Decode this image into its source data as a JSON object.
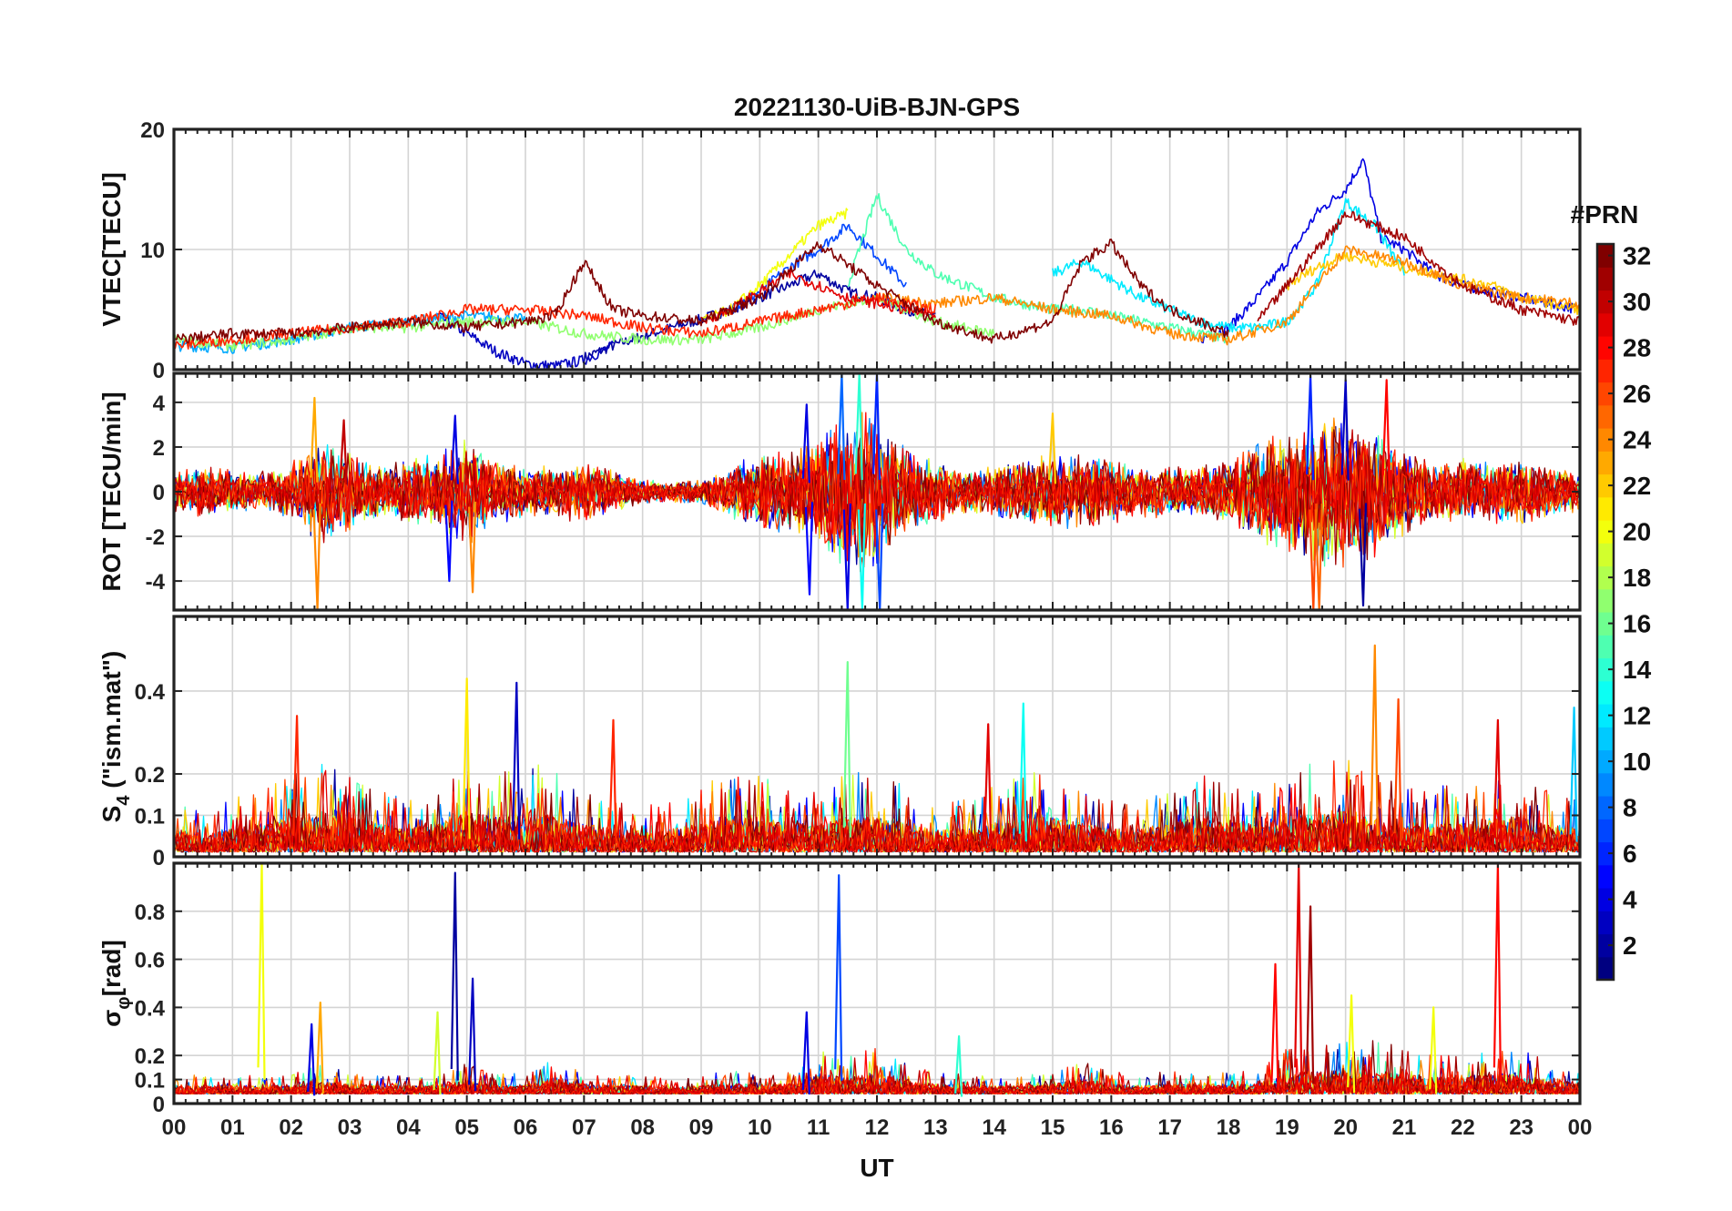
{
  "figure": {
    "title": "20221130-UiB-BJN-GPS",
    "xlabel": "UT",
    "colorbar_label": "#PRN"
  },
  "x_ticks": [
    "00",
    "01",
    "02",
    "03",
    "04",
    "05",
    "06",
    "07",
    "08",
    "09",
    "10",
    "11",
    "12",
    "13",
    "14",
    "15",
    "16",
    "17",
    "18",
    "19",
    "20",
    "21",
    "22",
    "23",
    "00"
  ],
  "colorbar": {
    "min": 1,
    "max": 32,
    "ticks": [
      2,
      4,
      6,
      8,
      10,
      12,
      14,
      16,
      18,
      20,
      22,
      24,
      26,
      28,
      30,
      32
    ]
  },
  "chart_data": [
    {
      "type": "line",
      "panel": "vtec",
      "ylabel": "VTEC[TECU]",
      "xlim": [
        0,
        24
      ],
      "ylim": [
        0,
        20
      ],
      "yticks": [
        0,
        10,
        20
      ],
      "ytick_labels": [
        "0",
        "10",
        "20"
      ],
      "grid": true,
      "series": [
        {
          "prn": 2,
          "x": [
            7,
            7.5,
            8,
            8.5,
            9,
            9.5,
            10,
            10.5,
            11,
            11.5,
            12,
            12.5,
            13
          ],
          "values": [
            1,
            2,
            2.8,
            3.5,
            4.2,
            5,
            6,
            7,
            8,
            6.5,
            6,
            5,
            4.5
          ]
        },
        {
          "prn": 3,
          "x": [
            4.5,
            5,
            5.5,
            6,
            6.5,
            7,
            7.5
          ],
          "values": [
            4.5,
            3,
            1.5,
            0.5,
            0.3,
            0.8,
            2
          ]
        },
        {
          "prn": 4,
          "x": [
            17.5,
            18,
            18.5,
            19,
            19.5,
            20,
            20.3,
            20.6,
            21,
            21.5,
            22,
            22.5,
            23,
            23.5,
            24
          ],
          "values": [
            2.5,
            3.5,
            6,
            9,
            13,
            15,
            17.5,
            11,
            10,
            8,
            7,
            6.5,
            6,
            5.5,
            5
          ]
        },
        {
          "prn": 7,
          "x": [
            9.5,
            10,
            10.5,
            11,
            11.5,
            12,
            12.5
          ],
          "values": [
            5,
            6.5,
            8.5,
            10,
            12,
            9.5,
            7
          ]
        },
        {
          "prn": 10,
          "x": [
            0,
            1,
            2,
            3,
            4,
            5,
            6
          ],
          "values": [
            2,
            1.8,
            2.5,
            3.5,
            4,
            4.5,
            4.2
          ]
        },
        {
          "prn": 12,
          "x": [
            15,
            15.5,
            16,
            16.5,
            17,
            17.5,
            18,
            18.5,
            19,
            19.5,
            20,
            20.5,
            21
          ],
          "values": [
            8,
            9,
            7.5,
            6,
            5,
            4,
            3.5,
            3.5,
            4,
            7,
            14,
            12,
            8
          ]
        },
        {
          "prn": 15,
          "x": [
            11.5,
            12,
            12.5,
            13,
            13.5,
            14,
            14.5,
            15,
            15.5,
            16,
            16.5,
            17,
            17.5,
            18
          ],
          "values": [
            7,
            14.5,
            10,
            8,
            7,
            6,
            5.5,
            5,
            5,
            4.5,
            4,
            3.5,
            3,
            2.5
          ]
        },
        {
          "prn": 17,
          "x": [
            0,
            1,
            2,
            3,
            4,
            5,
            6,
            7,
            8,
            9,
            10,
            11,
            12,
            13,
            14
          ],
          "values": [
            2.5,
            2,
            2.5,
            3.5,
            3.5,
            4,
            4,
            3,
            2.5,
            2.5,
            3.5,
            5,
            6,
            4,
            3
          ]
        },
        {
          "prn": 20,
          "x": [
            9,
            9.5,
            10,
            10.5,
            11,
            11.5
          ],
          "values": [
            4,
            5,
            7,
            9.5,
            12,
            13
          ]
        },
        {
          "prn": 22,
          "x": [
            19,
            19.5,
            20,
            20.5,
            21,
            21.5,
            22,
            22.5,
            23,
            23.5,
            24
          ],
          "values": [
            7,
            8.5,
            9.5,
            9,
            8.5,
            8,
            7.5,
            7,
            6,
            5.5,
            5
          ]
        },
        {
          "prn": 24,
          "x": [
            12,
            13,
            14,
            15,
            16,
            17,
            18,
            19,
            20,
            21,
            22,
            23,
            24
          ],
          "values": [
            6,
            5.5,
            6,
            5,
            4.5,
            3,
            2.5,
            4,
            10,
            9,
            7,
            6,
            5.5
          ]
        },
        {
          "prn": 27,
          "x": [
            0,
            1,
            2,
            3,
            4,
            5,
            6,
            7,
            8,
            9,
            10,
            11,
            12,
            13
          ],
          "values": [
            2,
            2.5,
            3,
            3.5,
            4,
            5,
            5,
            4.5,
            3.5,
            3,
            4,
            5,
            6,
            5
          ]
        },
        {
          "prn": 29,
          "x": [
            9,
            9.5,
            10,
            10.5,
            11,
            11.5,
            12,
            12.5,
            13
          ],
          "values": [
            4,
            5,
            6.5,
            8,
            7,
            6,
            5.5,
            5,
            4.5
          ]
        },
        {
          "prn": 31,
          "x": [
            18.5,
            19,
            19.5,
            20,
            20.5,
            21,
            21.5,
            22,
            22.5,
            23,
            23.5,
            24
          ],
          "values": [
            4,
            7,
            10,
            13,
            12,
            11,
            9,
            7,
            6,
            5,
            4.5,
            4
          ]
        },
        {
          "prn": 32,
          "x": [
            0,
            1,
            2,
            3,
            4,
            5,
            6,
            6.5,
            7,
            7.5,
            8,
            9,
            10,
            11,
            12,
            13,
            14,
            15,
            15.5,
            16,
            16.5,
            17,
            18
          ],
          "values": [
            2.5,
            3,
            3,
            3.5,
            4,
            3.5,
            4,
            4.5,
            9,
            5,
            4.5,
            4,
            6,
            10.5,
            7,
            4,
            2.5,
            4,
            9,
            10.5,
            7,
            5,
            3
          ]
        }
      ]
    },
    {
      "type": "line",
      "panel": "rot",
      "ylabel": "ROT [TECU/min]",
      "xlim": [
        0,
        24
      ],
      "ylim": [
        -5.3,
        5.3
      ],
      "yticks": [
        -4,
        -2,
        0,
        2,
        4
      ],
      "ytick_labels": [
        "-4",
        "-2",
        "0",
        "2",
        "4"
      ],
      "grid": true,
      "envelope": {
        "x": [
          0,
          0.5,
          1,
          1.5,
          2,
          2.5,
          3,
          3.5,
          4,
          4.5,
          5,
          5.5,
          6,
          6.5,
          7,
          7.5,
          8,
          8.5,
          9,
          9.5,
          10,
          10.5,
          11,
          11.5,
          12,
          12.5,
          13,
          13.5,
          14,
          14.5,
          15,
          15.5,
          16,
          16.5,
          17,
          17.5,
          18,
          18.5,
          19,
          19.5,
          20,
          20.5,
          21,
          21.5,
          22,
          22.5,
          23,
          23.5,
          24
        ],
        "values": [
          1,
          1.2,
          1,
          1,
          1.3,
          2.5,
          2,
          1.2,
          1.5,
          1.8,
          2.5,
          1.5,
          1.2,
          1.2,
          1.5,
          1,
          0.6,
          0.5,
          0.6,
          1.2,
          1.8,
          2,
          2.5,
          4,
          3.5,
          2,
          1.5,
          1,
          1.2,
          1.5,
          1.8,
          1.8,
          1.5,
          1.2,
          1.2,
          1.2,
          1.5,
          2.5,
          3,
          3.5,
          3.5,
          3,
          2.2,
          1.5,
          1.5,
          1.5,
          1.5,
          1.3,
          1
        ]
      },
      "spikes": [
        {
          "x": 2.4,
          "value": 4.2,
          "prn": 23
        },
        {
          "x": 2.45,
          "value": -5.3,
          "prn": 24
        },
        {
          "x": 2.9,
          "value": 3.2,
          "prn": 30
        },
        {
          "x": 4.8,
          "value": 3.4,
          "prn": 4
        },
        {
          "x": 4.7,
          "value": -4,
          "prn": 5
        },
        {
          "x": 5.1,
          "value": -4.5,
          "prn": 24
        },
        {
          "x": 10.8,
          "value": 3.9,
          "prn": 4
        },
        {
          "x": 10.85,
          "value": -4.6,
          "prn": 5
        },
        {
          "x": 11.4,
          "value": 5.3,
          "prn": 8
        },
        {
          "x": 11.5,
          "value": -5.3,
          "prn": 4
        },
        {
          "x": 11.7,
          "value": 5.3,
          "prn": 14
        },
        {
          "x": 11.75,
          "value": -5.3,
          "prn": 13
        },
        {
          "x": 12.0,
          "value": 5.3,
          "prn": 6
        },
        {
          "x": 12.05,
          "value": -5.3,
          "prn": 7
        },
        {
          "x": 15.0,
          "value": 3.5,
          "prn": 22
        },
        {
          "x": 19.4,
          "value": 5.2,
          "prn": 6
        },
        {
          "x": 19.45,
          "value": -5.3,
          "prn": 26
        },
        {
          "x": 19.55,
          "value": -5.3,
          "prn": 25
        },
        {
          "x": 20.0,
          "value": 5,
          "prn": 3
        },
        {
          "x": 20.3,
          "value": -5.1,
          "prn": 2
        },
        {
          "x": 20.7,
          "value": 5,
          "prn": 28
        }
      ]
    },
    {
      "type": "line",
      "panel": "s4",
      "ylabel": "S4 (\"ism.mat\")",
      "ylabel_main": "S",
      "ylabel_sub": "4",
      "ylabel_rest": " (\"ism.mat\")",
      "xlim": [
        0,
        24
      ],
      "ylim": [
        0,
        0.58
      ],
      "yticks": [
        0,
        0.1,
        0.2,
        0.4
      ],
      "ytick_labels": [
        "0",
        "0.1",
        "0.2",
        "0.4"
      ],
      "grid": true,
      "envelope": {
        "x": [
          0,
          0.5,
          1,
          1.5,
          2,
          2.5,
          3,
          3.5,
          4,
          4.5,
          5,
          5.5,
          6,
          6.5,
          7,
          7.5,
          8,
          8.5,
          9,
          9.5,
          10,
          10.5,
          11,
          11.5,
          12,
          12.5,
          13,
          13.5,
          14,
          14.5,
          15,
          15.5,
          16,
          16.5,
          17,
          17.5,
          18,
          18.5,
          19,
          19.5,
          20,
          20.5,
          21,
          21.5,
          22,
          22.5,
          23,
          23.5,
          24
        ],
        "values": [
          0.08,
          0.06,
          0.08,
          0.1,
          0.12,
          0.14,
          0.12,
          0.1,
          0.08,
          0.1,
          0.14,
          0.12,
          0.14,
          0.12,
          0.1,
          0.08,
          0.07,
          0.08,
          0.1,
          0.12,
          0.12,
          0.1,
          0.1,
          0.12,
          0.12,
          0.1,
          0.08,
          0.08,
          0.1,
          0.12,
          0.12,
          0.1,
          0.08,
          0.08,
          0.1,
          0.12,
          0.1,
          0.1,
          0.12,
          0.14,
          0.14,
          0.12,
          0.1,
          0.1,
          0.1,
          0.12,
          0.12,
          0.1,
          0.08
        ]
      },
      "spikes": [
        {
          "x": 2.1,
          "value": 0.34,
          "prn": 27
        },
        {
          "x": 5.0,
          "value": 0.43,
          "prn": 21
        },
        {
          "x": 5.85,
          "value": 0.42,
          "prn": 3
        },
        {
          "x": 7.5,
          "value": 0.33,
          "prn": 27
        },
        {
          "x": 11.5,
          "value": 0.47,
          "prn": 16
        },
        {
          "x": 13.9,
          "value": 0.32,
          "prn": 29
        },
        {
          "x": 14.5,
          "value": 0.37,
          "prn": 13
        },
        {
          "x": 20.5,
          "value": 0.51,
          "prn": 24
        },
        {
          "x": 20.9,
          "value": 0.38,
          "prn": 26
        },
        {
          "x": 22.6,
          "value": 0.33,
          "prn": 29
        },
        {
          "x": 23.9,
          "value": 0.36,
          "prn": 11
        }
      ]
    },
    {
      "type": "line",
      "panel": "sigma_phi",
      "ylabel": "σφ[rad]",
      "ylabel_main": "σ",
      "ylabel_sub": "φ",
      "ylabel_rest": "[rad]",
      "xlim": [
        0,
        24
      ],
      "ylim": [
        0,
        1
      ],
      "yticks": [
        0,
        0.1,
        0.2,
        0.4,
        0.6,
        0.8
      ],
      "ytick_labels": [
        "0",
        "0.1",
        "0.2",
        "0.4",
        "0.6",
        "0.8"
      ],
      "grid": true,
      "envelope": {
        "x": [
          0,
          0.5,
          1,
          1.5,
          2,
          2.5,
          3,
          3.5,
          4,
          4.5,
          5,
          5.5,
          6,
          6.5,
          7,
          7.5,
          8,
          8.5,
          9,
          9.5,
          10,
          10.5,
          11,
          11.5,
          12,
          12.5,
          13,
          13.5,
          14,
          14.5,
          15,
          15.5,
          16,
          16.5,
          17,
          17.5,
          18,
          18.5,
          19,
          19.5,
          20,
          20.5,
          21,
          21.5,
          22,
          22.5,
          23,
          23.5,
          24
        ],
        "values": [
          0.05,
          0.05,
          0.05,
          0.05,
          0.05,
          0.08,
          0.06,
          0.05,
          0.05,
          0.05,
          0.08,
          0.05,
          0.06,
          0.1,
          0.06,
          0.05,
          0.05,
          0.04,
          0.05,
          0.06,
          0.06,
          0.06,
          0.12,
          0.1,
          0.12,
          0.08,
          0.06,
          0.05,
          0.05,
          0.05,
          0.06,
          0.1,
          0.06,
          0.05,
          0.06,
          0.06,
          0.06,
          0.06,
          0.12,
          0.14,
          0.14,
          0.14,
          0.12,
          0.1,
          0.1,
          0.12,
          0.12,
          0.08,
          0.06
        ]
      },
      "spikes": [
        {
          "x": 1.5,
          "value": 1.0,
          "prn": 20
        },
        {
          "x": 2.35,
          "value": 0.33,
          "prn": 4
        },
        {
          "x": 2.5,
          "value": 0.42,
          "prn": 23
        },
        {
          "x": 4.5,
          "value": 0.38,
          "prn": 19
        },
        {
          "x": 4.8,
          "value": 0.96,
          "prn": 2
        },
        {
          "x": 5.1,
          "value": 0.52,
          "prn": 3
        },
        {
          "x": 10.8,
          "value": 0.38,
          "prn": 4
        },
        {
          "x": 11.35,
          "value": 0.95,
          "prn": 7
        },
        {
          "x": 13.4,
          "value": 0.28,
          "prn": 14
        },
        {
          "x": 18.8,
          "value": 0.58,
          "prn": 28
        },
        {
          "x": 19.2,
          "value": 1.0,
          "prn": 29
        },
        {
          "x": 19.4,
          "value": 0.82,
          "prn": 31
        },
        {
          "x": 20.1,
          "value": 0.45,
          "prn": 20
        },
        {
          "x": 21.5,
          "value": 0.4,
          "prn": 20
        },
        {
          "x": 22.6,
          "value": 1.0,
          "prn": 28
        }
      ]
    }
  ]
}
